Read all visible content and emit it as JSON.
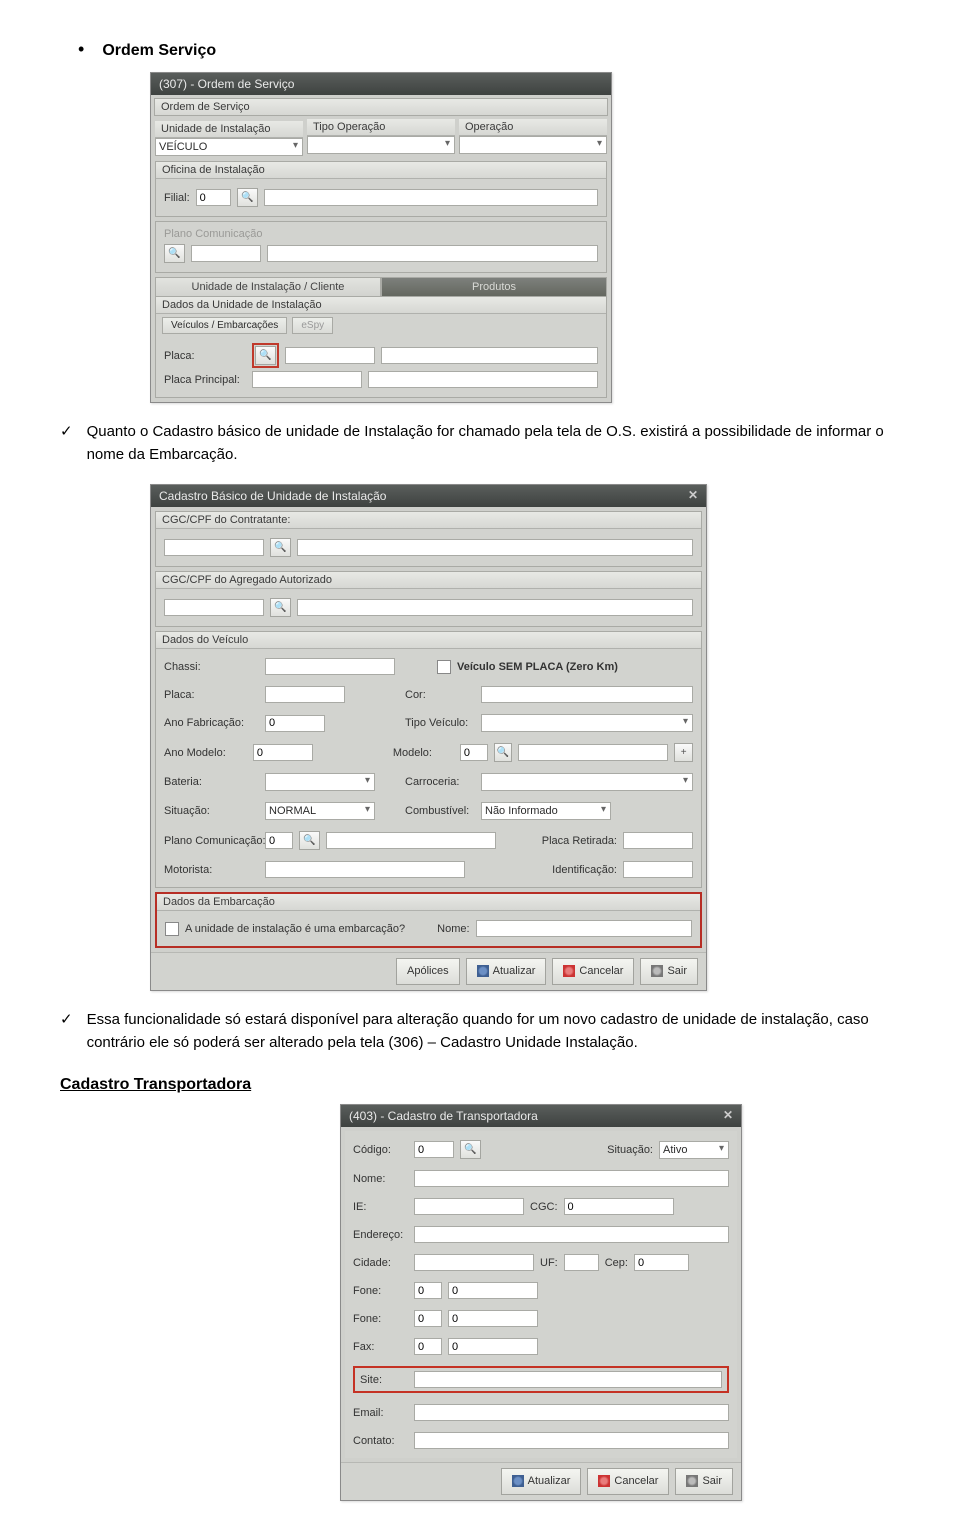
{
  "doc": {
    "bullet_title": "Ordem Serviço",
    "check1": "Quanto o Cadastro básico de unidade de Instalação for chamado pela tela de O.S. existirá a possibilidade de informar o nome da Embarcação.",
    "check2": "Essa funcionalidade só estará disponível para alteração quando for um novo cadastro de unidade de instalação, caso contrário ele só poderá ser alterado pela tela (306) – Cadastro Unidade Instalação.",
    "section2": "Cadastro Transportadora"
  },
  "win307": {
    "title": "(307) - Ordem de Serviço",
    "group1": "Ordem de Serviço",
    "col_unidade": "Unidade de Instalação",
    "col_tipo": "Tipo Operação",
    "col_operacao": "Operação",
    "veiculo_val": "VEÍCULO",
    "group2": "Oficina de Instalação",
    "filial_lbl": "Filial:",
    "filial_val": "0",
    "plano_dim": "Plano Comunicação",
    "tab_unidade": "Unidade de Instalação / Cliente",
    "tab_produtos": "Produtos",
    "group3": "Dados da Unidade de Instalação",
    "subtab1": "Veículos / Embarcações",
    "subtab2": "eSpy",
    "placa_lbl": "Placa:",
    "placa_princ_lbl": "Placa Principal:"
  },
  "winCad": {
    "title": "Cadastro Básico de Unidade de Instalação",
    "g1": "CGC/CPF do Contratante:",
    "g2": "CGC/CPF do Agregado Autorizado",
    "g3": "Dados do Veículo",
    "chassi": "Chassi:",
    "semplaca": "Veículo SEM PLACA (Zero Km)",
    "placa": "Placa:",
    "cor": "Cor:",
    "anofab": "Ano Fabricação:",
    "zero": "0",
    "tipoveic": "Tipo Veículo:",
    "anomod": "Ano Modelo:",
    "modelo": "Modelo:",
    "bateria": "Bateria:",
    "carroceria": "Carroceria:",
    "situacao": "Situação:",
    "situacao_val": "NORMAL",
    "combustivel": "Combustível:",
    "combustivel_val": "Não Informado",
    "planocom": "Plano Comunicação:",
    "placa_ret": "Placa Retirada:",
    "motorista": "Motorista:",
    "identificacao": "Identificação:",
    "g4": "Dados da Embarcação",
    "q": "A unidade de instalação é uma embarcação?",
    "nome": "Nome:",
    "btn_apolices": "Apólices",
    "btn_atualizar": "Atualizar",
    "btn_cancelar": "Cancelar",
    "btn_sair": "Sair"
  },
  "win403": {
    "title": "(403) - Cadastro de Transportadora",
    "codigo": "Código:",
    "zero": "0",
    "situacao": "Situação:",
    "situacao_val": "Ativo",
    "nome": "Nome:",
    "ie": "IE:",
    "cgc": "CGC:",
    "endereco": "Endereço:",
    "cidade": "Cidade:",
    "uf": "UF:",
    "cep": "Cep:",
    "fone": "Fone:",
    "fax": "Fax:",
    "site": "Site:",
    "email": "Email:",
    "contato": "Contato:",
    "btn_atualizar": "Atualizar",
    "btn_cancelar": "Cancelar",
    "btn_sair": "Sair"
  }
}
